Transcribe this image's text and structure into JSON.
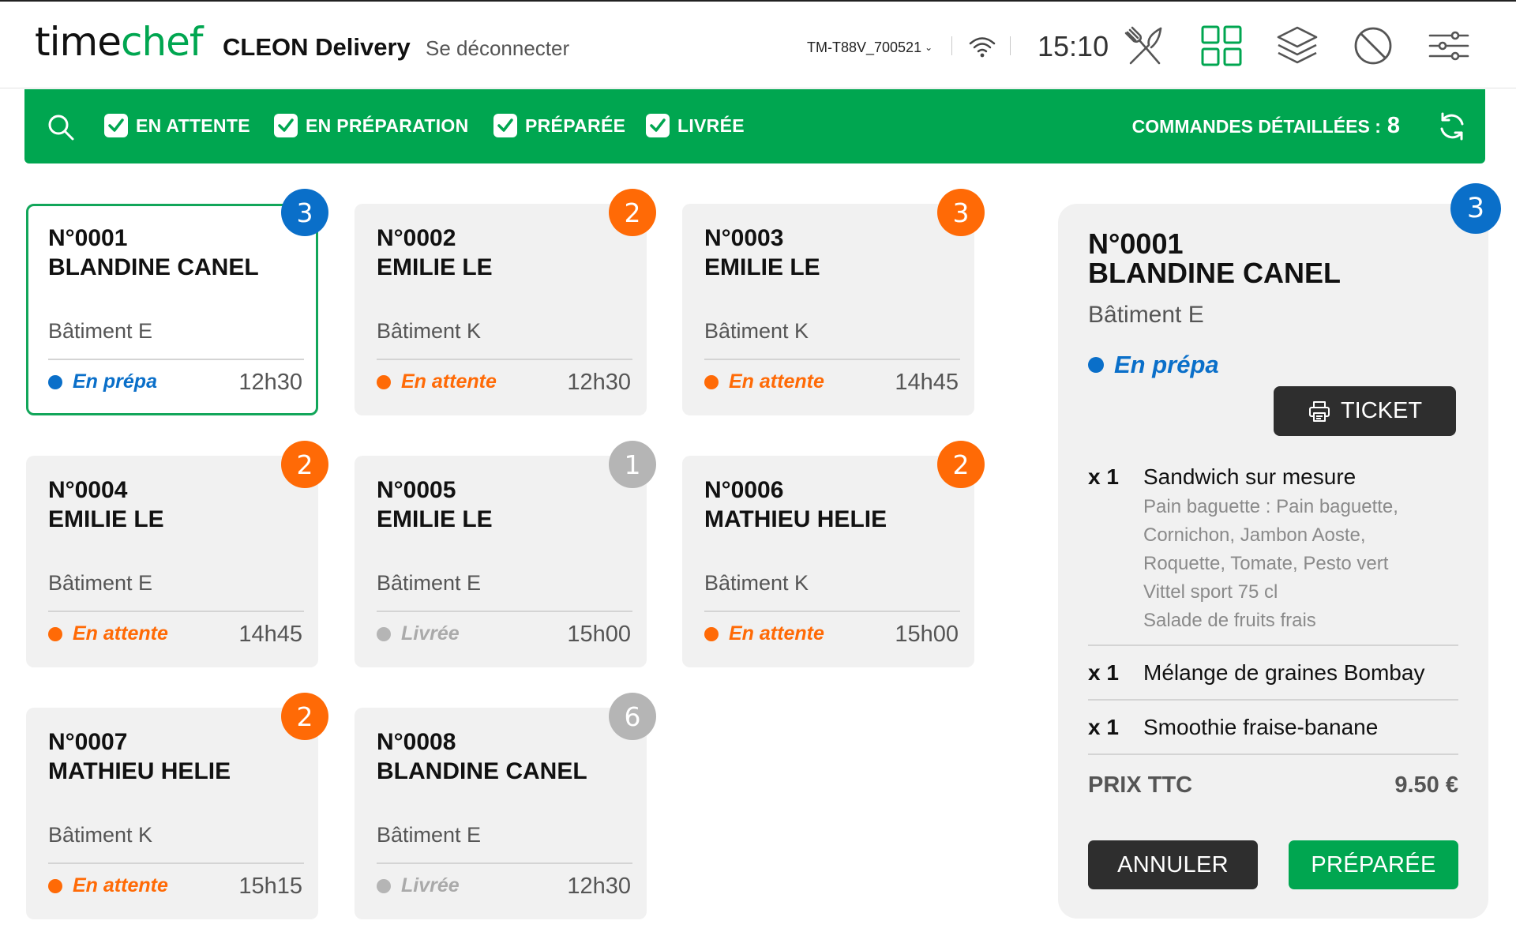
{
  "header": {
    "logo_part1": "time",
    "logo_part2": "chef",
    "store": "CLEON Delivery",
    "logout": "Se déconnecter",
    "device": "TM-T88V_700521",
    "time": "15:10",
    "icons": [
      "fork-knife-icon",
      "grid-icon",
      "layers-icon",
      "ban-icon",
      "sliders-icon"
    ],
    "accent": "#00a650"
  },
  "filters": {
    "items": [
      {
        "label": "EN ATTENTE",
        "checked": true
      },
      {
        "label": "EN PRÉPARATION",
        "checked": true
      },
      {
        "label": "PRÉPARÉE",
        "checked": true
      },
      {
        "label": "LIVRÉE",
        "checked": true
      }
    ],
    "count_label": "COMMANDES DÉTAILLÉES :",
    "count": "8"
  },
  "orders": [
    {
      "num": "N°0001",
      "name": "BLANDINE CANEL",
      "building": "Bâtiment E",
      "status": "En prépa",
      "status_color": "#0a6fc9",
      "time": "12h30",
      "badge": "3",
      "selected": true
    },
    {
      "num": "N°0002",
      "name": "EMILIE LE",
      "building": "Bâtiment K",
      "status": "En attente",
      "status_color": "#ff6a06",
      "time": "12h30",
      "badge": "2"
    },
    {
      "num": "N°0003",
      "name": "EMILIE LE",
      "building": "Bâtiment K",
      "status": "En attente",
      "status_color": "#ff6a06",
      "time": "14h45",
      "badge": "3"
    },
    {
      "num": "N°0004",
      "name": "EMILIE LE",
      "building": "Bâtiment E",
      "status": "En attente",
      "status_color": "#ff6a06",
      "time": "14h45",
      "badge": "2"
    },
    {
      "num": "N°0005",
      "name": "EMILIE LE",
      "building": "Bâtiment E",
      "status": "Livrée",
      "status_color": "#aaaaaa",
      "time": "15h00",
      "badge": "1"
    },
    {
      "num": "N°0006",
      "name": "MATHIEU HELIE",
      "building": "Bâtiment K",
      "status": "En attente",
      "status_color": "#ff6a06",
      "time": "15h00",
      "badge": "2"
    },
    {
      "num": "N°0007",
      "name": "MATHIEU HELIE",
      "building": "Bâtiment K",
      "status": "En attente",
      "status_color": "#ff6a06",
      "time": "15h15",
      "badge": "2"
    },
    {
      "num": "N°0008",
      "name": "BLANDINE CANEL",
      "building": "Bâtiment E",
      "status": "Livrée",
      "status_color": "#aaaaaa",
      "time": "12h30",
      "badge": "6"
    }
  ],
  "detail": {
    "badge": "3",
    "num": "N°0001",
    "name": "BLANDINE CANEL",
    "building": "Bâtiment E",
    "status": "En prépa",
    "ticket_label": "TICKET",
    "lines": [
      {
        "qty": "x 1",
        "item": "Sandwich sur mesure",
        "details": [
          "Pain baguette : Pain baguette,",
          "Cornichon, Jambon Aoste,",
          "Roquette, Tomate, Pesto vert",
          "Vittel sport 75 cl",
          "Salade de fruits frais"
        ]
      },
      {
        "qty": "x 1",
        "item": "Mélange de graines Bombay",
        "details": []
      },
      {
        "qty": "x 1",
        "item": "Smoothie fraise-banane",
        "details": []
      }
    ],
    "price_label": "PRIX TTC",
    "price": "9.50 €",
    "cancel_label": "ANNULER",
    "ready_label": "PRÉPARÉE"
  }
}
